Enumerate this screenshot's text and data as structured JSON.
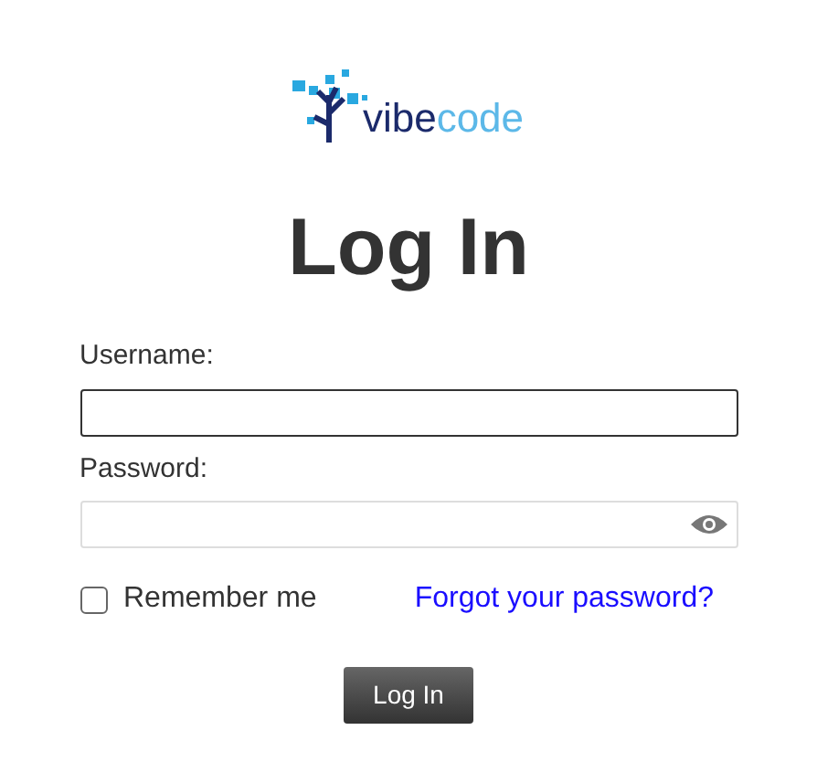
{
  "logo": {
    "text_main": "vibe",
    "text_accent": "code"
  },
  "title": "Log In",
  "fields": [
    {
      "label": "Username:",
      "kind": "text",
      "focused": true
    },
    {
      "label": "Password:",
      "kind": "password",
      "focused": false
    }
  ],
  "remember": {
    "label": "Remember me",
    "checked": false
  },
  "forgot_link": "Forgot your password?",
  "submit": "Log In"
}
